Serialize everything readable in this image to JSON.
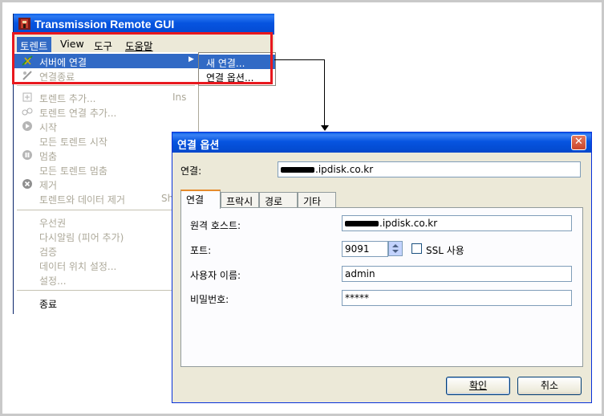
{
  "app": {
    "title": "Transmission Remote GUI",
    "menubar": [
      "토렌트",
      "View",
      "도구",
      "도움말"
    ]
  },
  "torrent_menu": {
    "items": [
      {
        "label": "서버에 연결",
        "shortcut": "",
        "state": "highlighted",
        "icon": "connect-icon",
        "has_submenu": true
      },
      {
        "label": "연결종료",
        "shortcut": "",
        "state": "disabled",
        "icon": "disconnect-icon"
      },
      {
        "label": "토렌트 추가...",
        "shortcut": "Ins",
        "state": "disabled",
        "icon": "add-torrent-icon"
      },
      {
        "label": "토렌트 연결 추가...",
        "shortcut": "",
        "state": "disabled",
        "icon": "add-link-icon"
      },
      {
        "label": "시작",
        "shortcut": "",
        "state": "disabled",
        "icon": "play-icon"
      },
      {
        "label": "모든 토렌트 시작",
        "shortcut": "",
        "state": "disabled",
        "icon": ""
      },
      {
        "label": "멈춤",
        "shortcut": "",
        "state": "disabled",
        "icon": "pause-icon"
      },
      {
        "label": "모든 토렌트 멈춤",
        "shortcut": "",
        "state": "disabled",
        "icon": ""
      },
      {
        "label": "제거",
        "shortcut": "",
        "state": "disabled",
        "icon": "remove-icon"
      },
      {
        "label": "토렌트와 데이터 제거",
        "shortcut": "Shift+",
        "state": "disabled",
        "icon": ""
      },
      {
        "label": "우선권",
        "shortcut": "",
        "state": "disabled",
        "icon": ""
      },
      {
        "label": "다시알림 (피어 추가)",
        "shortcut": "",
        "state": "disabled",
        "icon": ""
      },
      {
        "label": "검증",
        "shortcut": "",
        "state": "disabled",
        "icon": ""
      },
      {
        "label": "데이터 위치 설정...",
        "shortcut": "",
        "state": "disabled",
        "icon": ""
      },
      {
        "label": "설정...",
        "shortcut": "",
        "state": "disabled",
        "icon": ""
      },
      {
        "label": "종료",
        "shortcut": "",
        "state": "enabled",
        "icon": ""
      }
    ]
  },
  "submenu": {
    "items": [
      {
        "label": "새 연결...",
        "state": "highlighted"
      },
      {
        "label": "연결 옵션...",
        "state": "normal"
      }
    ]
  },
  "dialog": {
    "title": "연결 옵션",
    "connection_label": "연결:",
    "connection_value": ".ipdisk.co.kr",
    "tabs": [
      "연결",
      "프락시",
      "경로",
      "기타"
    ],
    "active_tab": "연결",
    "fields": {
      "host_label": "원격 호스트:",
      "host_value": ".ipdisk.co.kr",
      "port_label": "포트:",
      "port_value": "9091",
      "ssl_label": "SSL 사용",
      "ssl_checked": false,
      "user_label": "사용자 이름:",
      "user_value": "admin",
      "password_label": "비밀번호:",
      "password_value": "*****"
    },
    "ok_label": "확인",
    "cancel_label": "취소"
  },
  "colors": {
    "xp_blue": "#0654e0",
    "menu_highlight": "#316ac5",
    "annotation_red": "#e8181e",
    "dialog_face": "#ece9d8"
  }
}
